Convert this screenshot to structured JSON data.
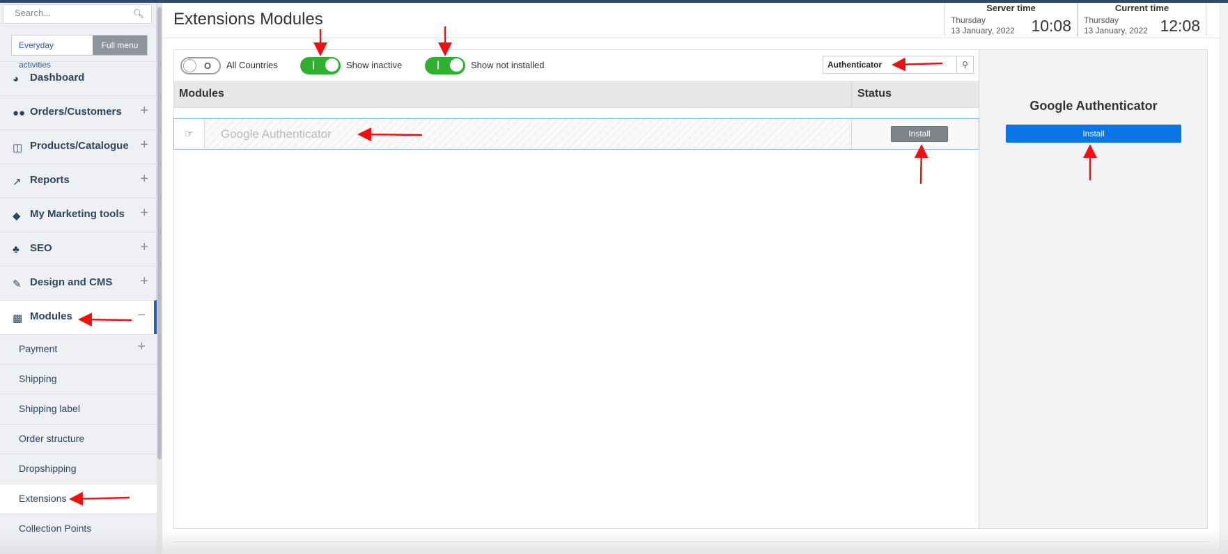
{
  "sidebar": {
    "search_placeholder": "Search...",
    "modes": [
      "Everyday activities",
      "Full menu"
    ],
    "items": [
      {
        "label": "Dashboard",
        "icon": "dashboard-icon",
        "glyph": "◕"
      },
      {
        "label": "Orders/Customers",
        "icon": "users-icon",
        "glyph": "👥"
      },
      {
        "label": "Products/Catalogue",
        "icon": "folder-icon",
        "glyph": "🗁"
      },
      {
        "label": "Reports",
        "icon": "chart-icon",
        "glyph": "📈"
      },
      {
        "label": "My Marketing tools",
        "icon": "tag-icon",
        "glyph": "◆"
      },
      {
        "label": "SEO",
        "icon": "sitemap-icon",
        "glyph": "♣"
      },
      {
        "label": "Design and CMS",
        "icon": "brush-icon",
        "glyph": "✎"
      },
      {
        "label": "Modules",
        "icon": "puzzle-icon",
        "glyph": "✚"
      }
    ],
    "sub_items": [
      "Payment",
      "Shipping",
      "Shipping label",
      "Order structure",
      "Dropshipping",
      "Extensions",
      "Collection Points"
    ],
    "plus": "+",
    "minus": "−"
  },
  "header": {
    "title": "Extensions Modules",
    "server_time": {
      "label": "Server time",
      "day": "Thursday",
      "date": "13 January, 2022",
      "time": "10:08"
    },
    "current_time": {
      "label": "Current time",
      "day": "Thursday",
      "date": "13 January, 2022",
      "time": "12:08"
    }
  },
  "filters": {
    "all_countries": {
      "label": "All Countries",
      "state": "O",
      "on": false
    },
    "show_inactive": {
      "label": "Show inactive",
      "state": "|",
      "on": true
    },
    "show_not_installed": {
      "label": "Show not installed",
      "state": "|",
      "on": true
    },
    "search_value": "Authenticator"
  },
  "table": {
    "col_modules": "Modules",
    "col_status": "Status",
    "rows": [
      {
        "name": "Google Authenticator",
        "action": "Install"
      }
    ]
  },
  "details": {
    "title": "Google Authenticator",
    "action": "Install"
  },
  "colors": {
    "accent": "#0a75e6",
    "toggle_on": "#2fb12f",
    "nav_text": "#2d4660",
    "annotation": "#e11"
  }
}
